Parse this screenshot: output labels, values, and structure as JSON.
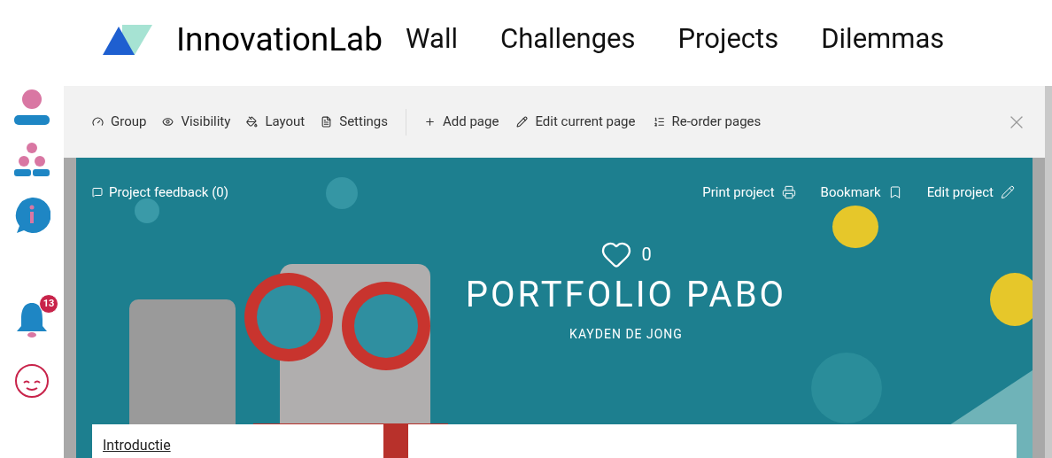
{
  "brand": {
    "name": "InnovationLab"
  },
  "nav": [
    {
      "label": "Wall"
    },
    {
      "label": "Challenges"
    },
    {
      "label": "Projects"
    },
    {
      "label": "Dilemmas"
    }
  ],
  "sidebar": {
    "notification_count": "13"
  },
  "toolbar": {
    "left": [
      {
        "label": "Group"
      },
      {
        "label": "Visibility"
      },
      {
        "label": "Layout"
      },
      {
        "label": "Settings"
      }
    ],
    "right": [
      {
        "label": "Add page"
      },
      {
        "label": "Edit current page"
      },
      {
        "label": "Re-order pages"
      }
    ]
  },
  "project": {
    "feedback": "Project feedback (0)",
    "actions": [
      {
        "label": "Print project"
      },
      {
        "label": "Bookmark"
      },
      {
        "label": "Edit project"
      }
    ],
    "likes": "0",
    "title": "PORTFOLIO PABO",
    "author": "KAYDEN DE JONG"
  },
  "pages": [
    {
      "label": "Introductie"
    }
  ]
}
